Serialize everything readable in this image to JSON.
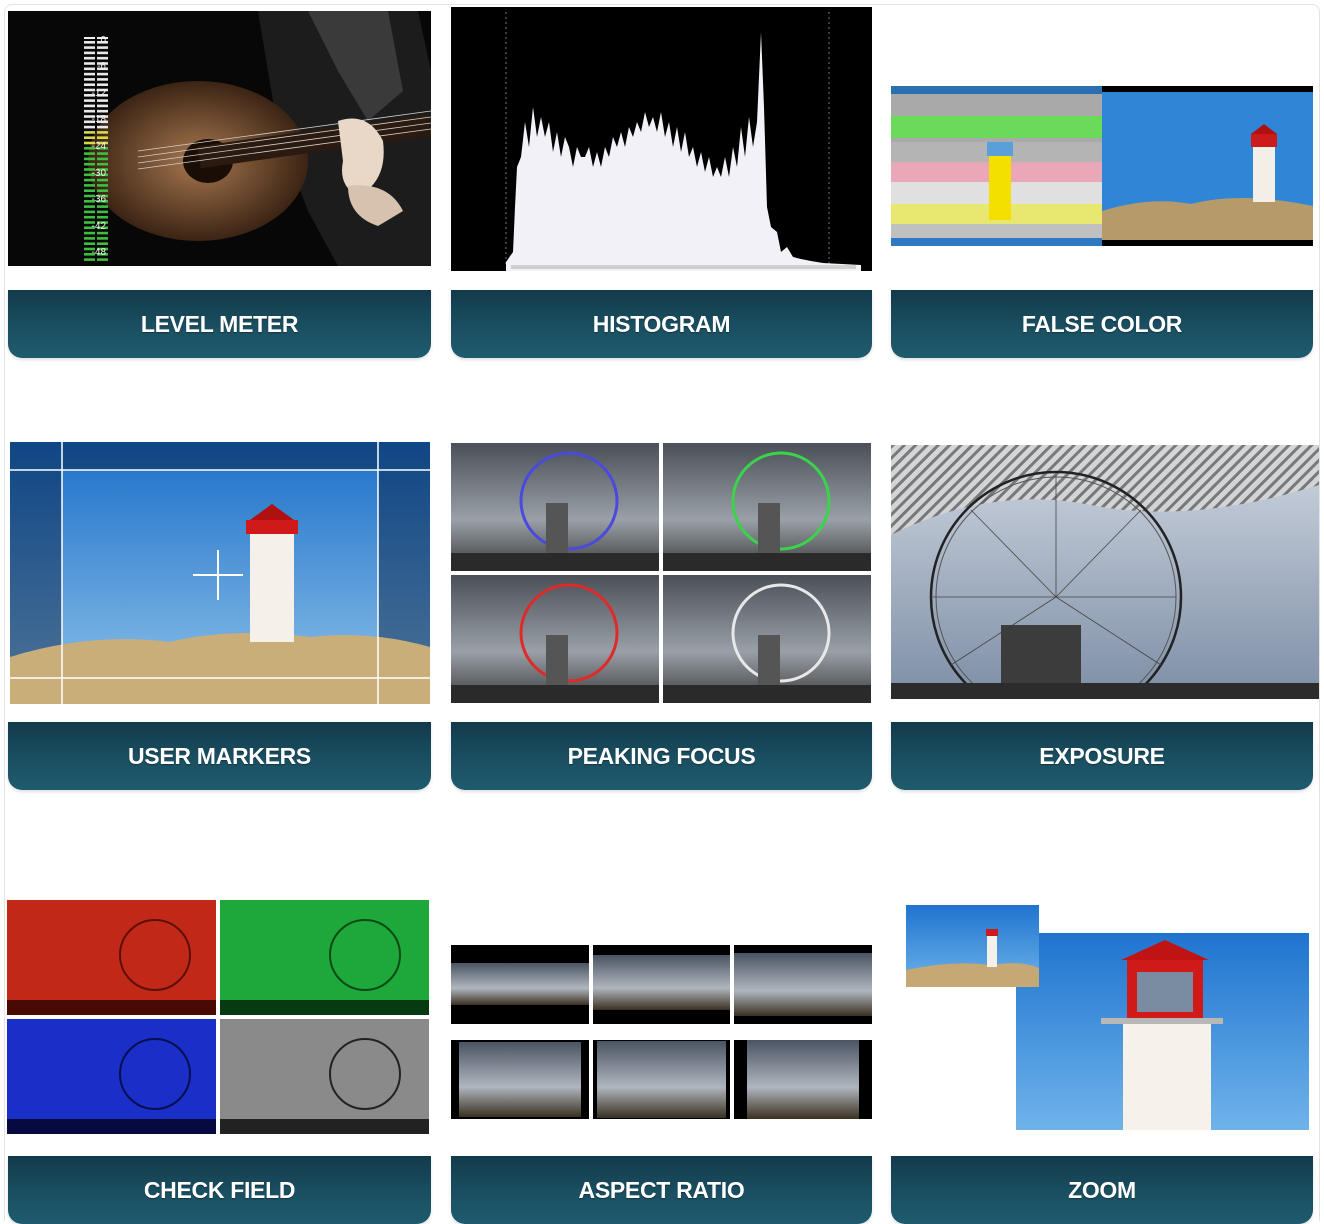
{
  "tiles": [
    {
      "label": "LEVEL METER"
    },
    {
      "label": "HISTOGRAM"
    },
    {
      "label": "FALSE COLOR"
    },
    {
      "label": "USER MARKERS"
    },
    {
      "label": "PEAKING FOCUS"
    },
    {
      "label": "EXPOSURE"
    },
    {
      "label": "CHECK FIELD"
    },
    {
      "label": "ASPECT RATIO"
    },
    {
      "label": "ZOOM"
    }
  ],
  "level_meter": {
    "ticks": [
      "0",
      "-6",
      "-12",
      "-18",
      "-24",
      "-30",
      "-36",
      "-42",
      "-48"
    ]
  },
  "colors": {
    "label_dark": "#123a4a",
    "label_light": "#1e5b6e",
    "sky": "#2f86d6",
    "lighthouse_red": "#d01a1a"
  },
  "icons": [
    "guitar-photo",
    "histogram-graph",
    "lighthouse-photo",
    "ferris-wheel-photo",
    "crosshair-icon"
  ]
}
